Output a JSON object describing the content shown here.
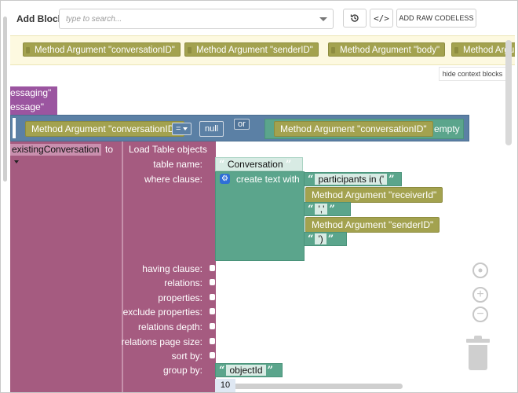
{
  "toolbar": {
    "add_block_label": "Add Block:",
    "search_placeholder": "type to search...",
    "raw_codeless_label": "ADD RAW CODELESS",
    "history_icon": "history-icon",
    "code_icon_text": "</>"
  },
  "context_bar": {
    "blocks": [
      "Method Argument \"conversationID\"",
      "Method Argument \"senderID\"",
      "Method Argument \"body\"",
      "Method Argume"
    ],
    "hide_label": "hide context blocks"
  },
  "workspace": {
    "purple_lines": [
      "essaging\"",
      "essage\""
    ],
    "condition": {
      "arg_left": "Method Argument \"conversationID\"",
      "operator": "=",
      "null_label": "null",
      "or_label": "or",
      "arg_right": "Method Argument \"conversationID\"",
      "is_empty_label": "is empty"
    },
    "set_block": {
      "variable": "existingConversation",
      "to_label": "to",
      "load_label": "Load Table objects"
    },
    "params": {
      "table_name": "table name:",
      "where_clause": "where clause:",
      "having_clause": "having clause:",
      "relations": "relations:",
      "properties": "properties:",
      "exclude_properties": "exclude properties:",
      "relations_depth": "relations depth:",
      "relations_page_size": "relations page size:",
      "sort_by": "sort by:",
      "group_by": "group by:"
    },
    "table_name_value": "Conversation",
    "create_text_label": "create text with",
    "text_parts": {
      "p1": "participants in ('",
      "p2": "Method Argument \"receiverId\"",
      "p3": "','",
      "p4": "Method Argument \"senderID\"",
      "p5": "')"
    },
    "group_by_value": "objectId",
    "bottom_value": "10"
  },
  "colors": {
    "purple": "#9b55a0",
    "blue": "#5b80a5",
    "olive": "#a3a24f",
    "green": "#5ba58c",
    "pink": "#a55b80"
  }
}
